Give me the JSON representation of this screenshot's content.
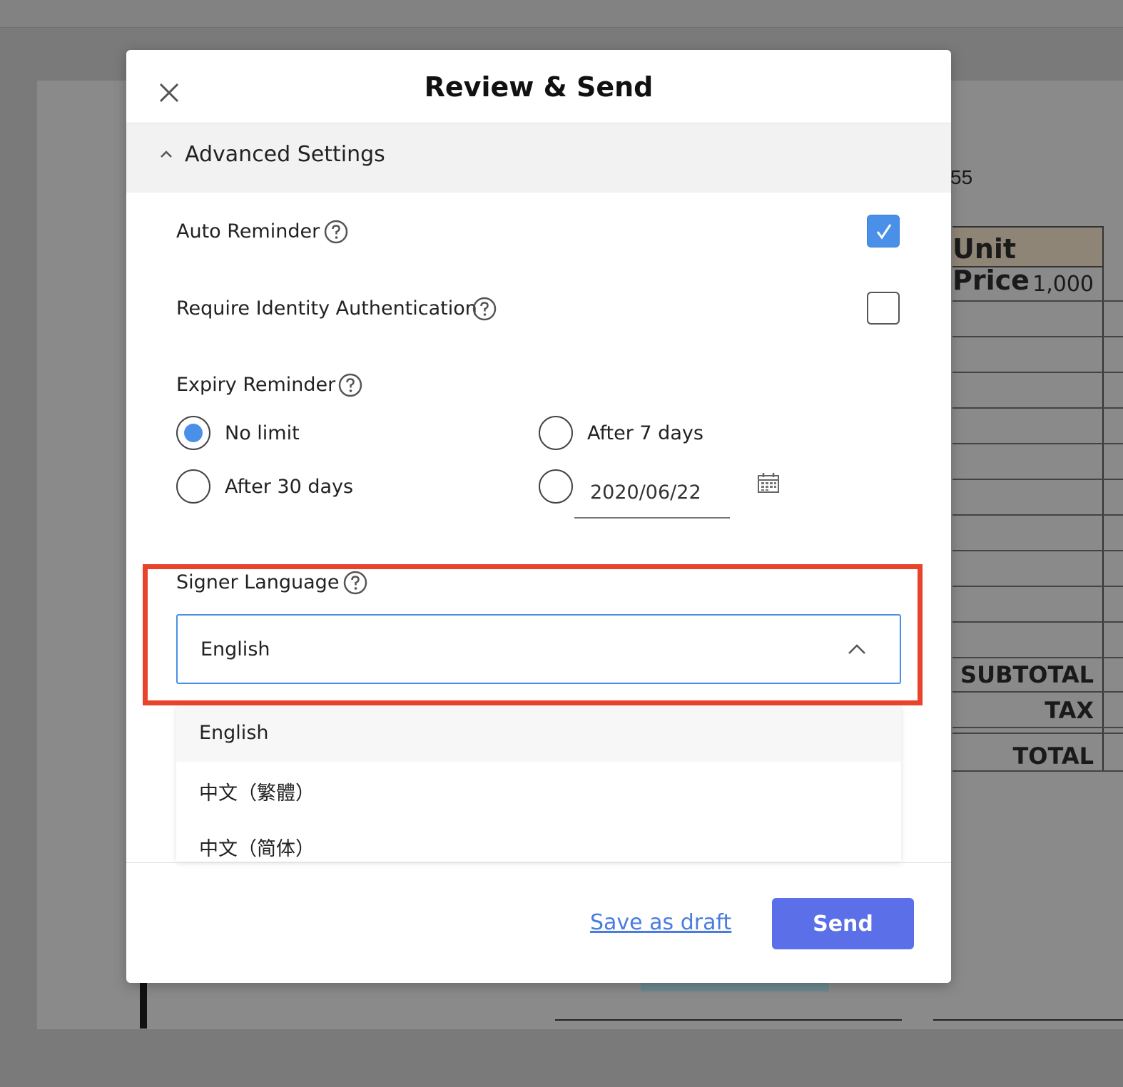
{
  "background_document": {
    "phone_fragment": "55",
    "column_header": "Unit Price",
    "first_value": "1,000",
    "subtotal_label": "SUBTOTAL",
    "tax_label": "TAX",
    "total_label": "TOTAL"
  },
  "modal": {
    "title": "Review & Send",
    "close_icon": "close-icon",
    "advanced_settings": {
      "label": "Advanced Settings",
      "expanded": true
    },
    "auto_reminder": {
      "label": "Auto Reminder",
      "checked": true
    },
    "identity_auth": {
      "label": "Require Identity Authentication",
      "checked": false
    },
    "expiry_reminder": {
      "label": "Expiry Reminder",
      "options": [
        {
          "label": "No limit",
          "selected": true
        },
        {
          "label": "After 7 days",
          "selected": false
        },
        {
          "label": "After 30 days",
          "selected": false
        }
      ],
      "custom_date": {
        "value": "2020/06/22",
        "selected": false
      }
    },
    "signer_language": {
      "label": "Signer Language",
      "selected": "English",
      "options": [
        "English",
        "中文（繁體）",
        "中文（简体）"
      ]
    },
    "footer": {
      "draft_label": "Save as draft",
      "send_label": "Send"
    }
  },
  "colors": {
    "accent_blue": "#4a90e8",
    "send_button": "#5a6fe8",
    "highlight_red": "#e8432b"
  }
}
